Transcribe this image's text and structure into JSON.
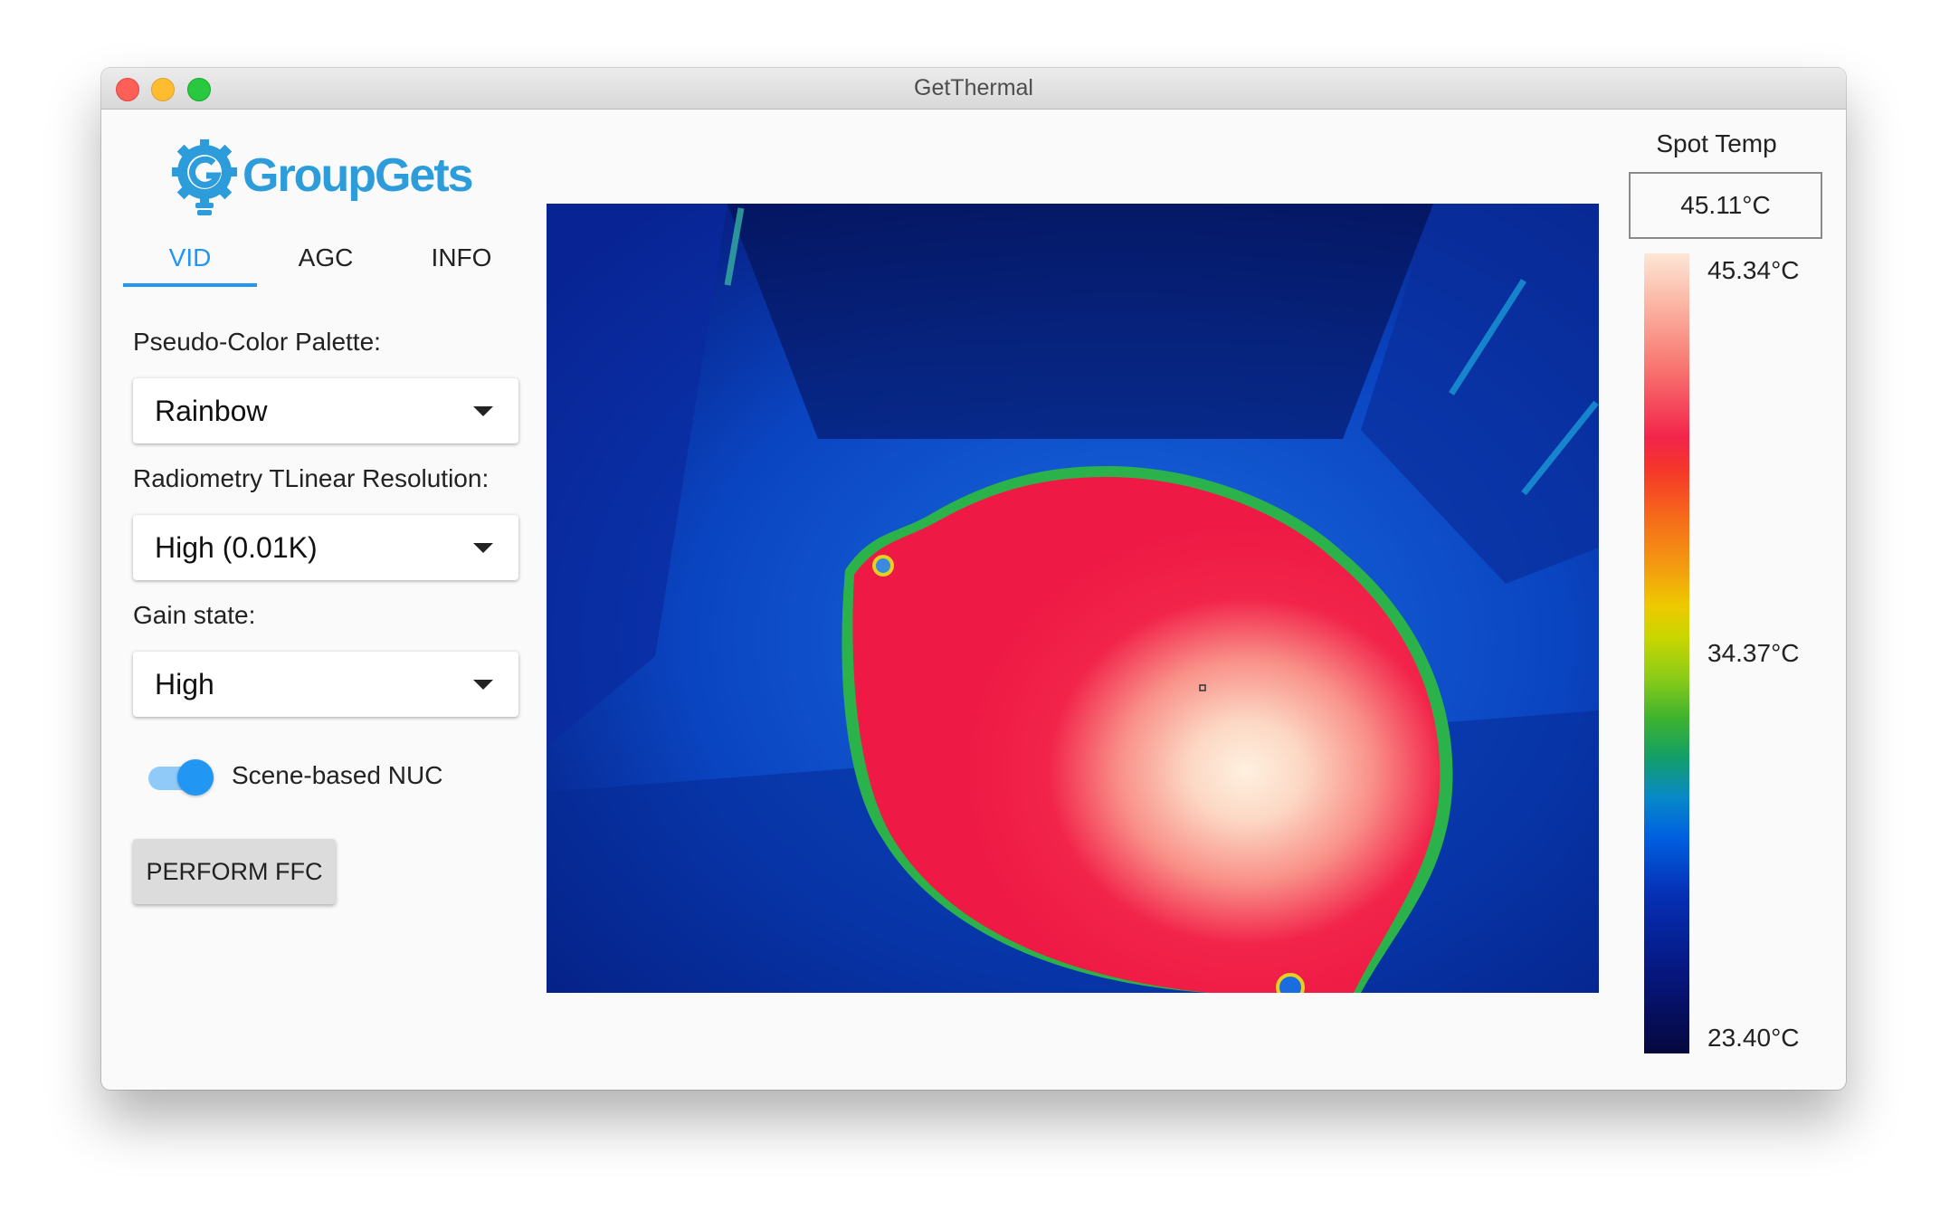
{
  "window": {
    "title": "GetThermal"
  },
  "logo": {
    "text": "GroupGets"
  },
  "tabs": [
    {
      "label": "VID",
      "active": true
    },
    {
      "label": "AGC",
      "active": false
    },
    {
      "label": "INFO",
      "active": false
    }
  ],
  "controls": {
    "palette_label": "Pseudo-Color Palette:",
    "palette_value": "Rainbow",
    "resolution_label": "Radiometry TLinear Resolution:",
    "resolution_value": "High (0.01K)",
    "gain_label": "Gain state:",
    "gain_value": "High",
    "nuc_label": "Scene-based NUC",
    "nuc_enabled": true,
    "ffc_button": "PERFORM FFC"
  },
  "spot_temp": {
    "title": "Spot Temp",
    "value": "45.11°C"
  },
  "color_scale": {
    "max": "45.34°C",
    "mid": "34.37°C",
    "min": "23.40°C"
  },
  "colors": {
    "accent": "#2196f3",
    "logo_blue": "#2c9cdb"
  }
}
